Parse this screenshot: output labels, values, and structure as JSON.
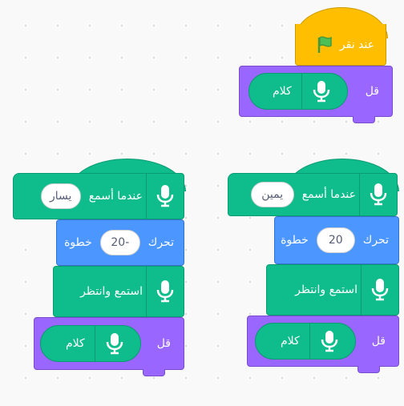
{
  "flag_stack": {
    "hat_label": "عند نقر",
    "say_label": "قل",
    "reporter_label": "كلام"
  },
  "right_stack": {
    "hat_label": "عندما أسمع",
    "hat_value": "يمين",
    "move_label": "تحرك",
    "move_value": "20",
    "move_unit": "خطوة",
    "listen_label": "استمع وانتظر",
    "say_label": "قل",
    "reporter_label": "كلام"
  },
  "left_stack": {
    "hat_label": "عندما أسمع",
    "hat_value": "يسار",
    "move_label": "تحرك",
    "move_value": "-20",
    "move_unit": "خطوة",
    "listen_label": "استمع وانتظر",
    "say_label": "قل",
    "reporter_label": "كلام"
  },
  "colors": {
    "events": "#ffbf00",
    "extension": "#0fbd8c",
    "motion": "#4c97ff",
    "looks": "#9966ff"
  }
}
